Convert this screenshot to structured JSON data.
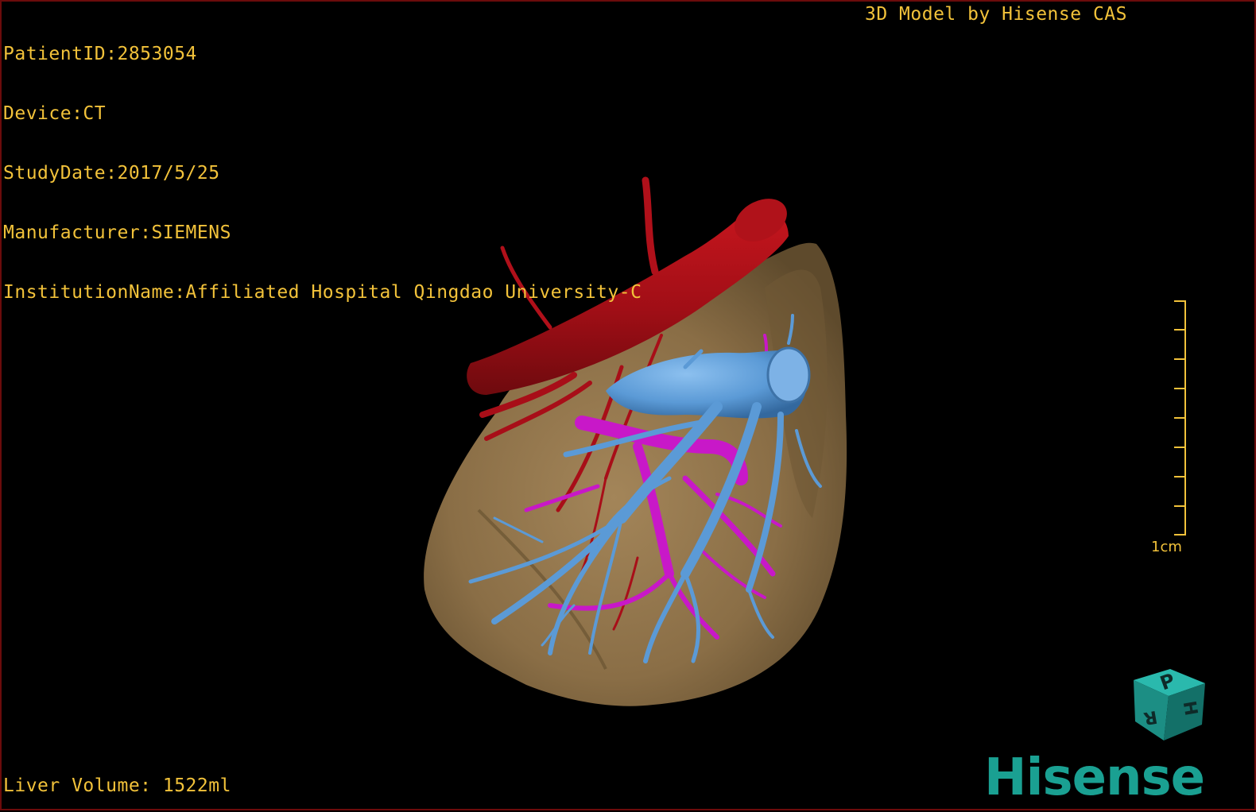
{
  "dicom": {
    "patient_id": "PatientID:2853054",
    "device": "Device:CT",
    "study_date": "StudyDate:2017/5/25",
    "manufacturer": "Manufacturer:SIEMENS",
    "institution": "InstitutionName:Affiliated Hospital Qingdao University-C"
  },
  "header": {
    "brand_title": "3D Model by Hisense CAS"
  },
  "footer": {
    "liver_volume": "Liver Volume: 1522ml"
  },
  "scale": {
    "label": "1cm"
  },
  "orientation_cube": {
    "face_top": "P",
    "face_right": "H",
    "face_front": "R"
  },
  "logo": {
    "text": "Hisense"
  },
  "colors": {
    "overlay_text": "#f2c23a",
    "liver": "#8a6e46",
    "artery": "#b0101a",
    "portal_vein": "#c818c8",
    "hepatic_vein": "#5b9ad6",
    "brand": "#1aa092"
  }
}
